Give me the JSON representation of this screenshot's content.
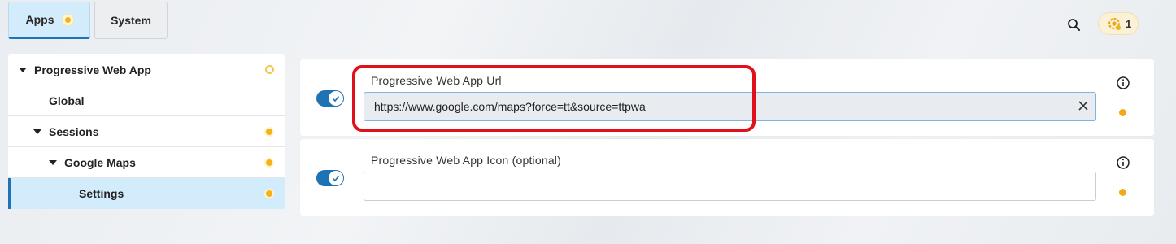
{
  "tabs": [
    {
      "label": "Apps"
    },
    {
      "label": "System"
    }
  ],
  "header": {
    "notification_count": "1"
  },
  "sidebar": {
    "items": [
      {
        "label": "Progressive Web App"
      },
      {
        "label": "Global"
      },
      {
        "label": "Sessions"
      },
      {
        "label": "Google Maps"
      },
      {
        "label": "Settings"
      }
    ]
  },
  "fields": [
    {
      "label": "Progressive Web App Url",
      "value": "https://www.google.com/maps?force=tt&source=ttpwa",
      "enabled": true
    },
    {
      "label": "Progressive Web App Icon (optional)",
      "value": "",
      "enabled": true
    }
  ],
  "colors": {
    "accent": "#1e73b4",
    "status_dot": "#f3b21a",
    "highlight": "#e0111b"
  },
  "icons": [
    "search-icon",
    "notification-icon",
    "info-icon",
    "clear-icon",
    "check-icon"
  ]
}
